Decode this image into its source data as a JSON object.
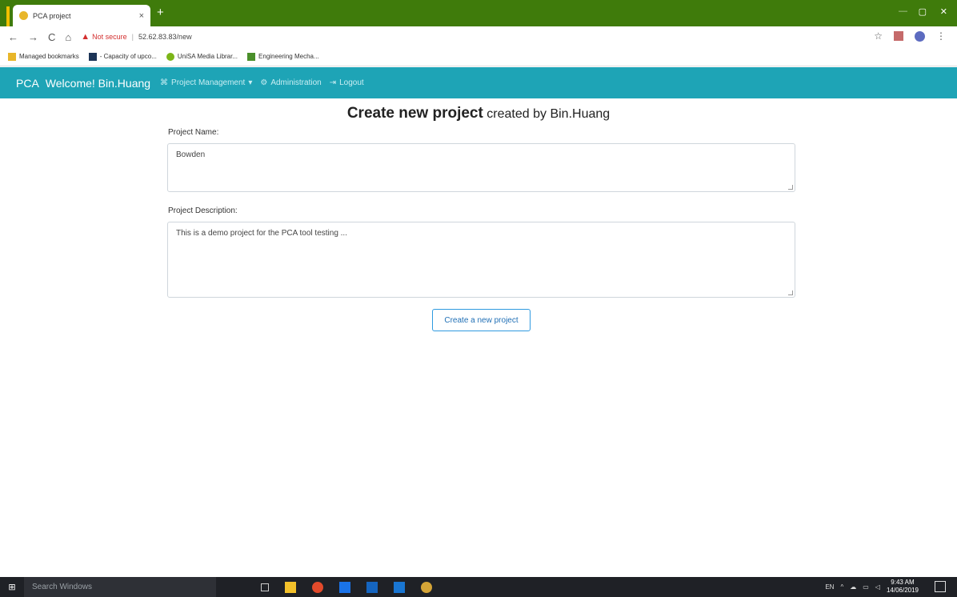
{
  "browser": {
    "tab_title": "PCA project",
    "tab_close": "×",
    "new_tab": "+",
    "window_controls": {
      "minimize": "—",
      "maximize": "▢",
      "close": "✕"
    },
    "nav": {
      "back": "←",
      "forward": "→",
      "reload": "C",
      "home": "⌂"
    },
    "security_label": "Not secure",
    "url": "52.62.83.83/new",
    "star": "☆"
  },
  "bookmarks": [
    {
      "label": "Managed bookmarks",
      "icon": "folder-icon"
    },
    {
      "label": "- Capacity of upco...",
      "icon": "doc-icon"
    },
    {
      "label": "UniSA Media Librar...",
      "icon": "unisa-icon"
    },
    {
      "label": "Engineering Mecha...",
      "icon": "engineering-icon"
    }
  ],
  "appnav": {
    "brand": "PCA",
    "welcome": "Welcome! Bin.Huang",
    "project_management": "Project Management",
    "administration": "Administration",
    "logout": "Logout"
  },
  "page": {
    "title_bold": "Create new project",
    "title_sub": "created by Bin.Huang",
    "name_label": "Project Name:",
    "name_value": "Bowden",
    "desc_label": "Project Description:",
    "desc_value": "This is a demo project for the PCA tool testing ...",
    "submit_label": "Create a new project"
  },
  "taskbar": {
    "search_placeholder": "Search Windows",
    "language": "EN",
    "time": "9:43 AM",
    "date": "14/06/2019"
  },
  "colors": {
    "chrome_frame": "#3f7b0b",
    "app_navbar": "#1ea4b6",
    "button_border": "#2f9ae0",
    "taskbar": "#1f2126"
  }
}
